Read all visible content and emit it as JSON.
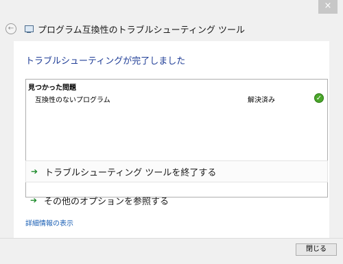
{
  "window": {
    "title": "プログラム互換性のトラブルシューティング ツール",
    "close_glyph": "×"
  },
  "header": {
    "back_glyph": "←"
  },
  "main": {
    "heading": "トラブルシューティングが完了しました",
    "issues": {
      "header": "見つかった問題",
      "rows": [
        {
          "name": "互換性のないプログラム",
          "status": "解決済み",
          "status_icon": "check-icon"
        }
      ]
    },
    "actions": [
      {
        "label": "トラブルシューティング ツールを終了する",
        "icon": "green-arrow-icon"
      },
      {
        "label": "その他のオプションを参照する",
        "icon": "green-arrow-icon"
      }
    ],
    "details_link": "詳細情報の表示"
  },
  "footer": {
    "close_button": "閉じる"
  },
  "colors": {
    "heading": "#1e3c96",
    "link": "#1a5fb4",
    "arrow": "#1c8a2a",
    "check": "#4aa62a"
  }
}
